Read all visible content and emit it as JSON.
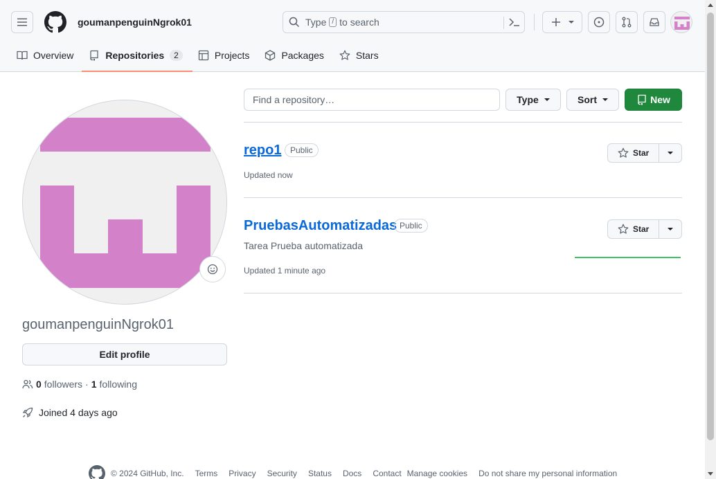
{
  "header": {
    "username": "goumanpenguinNgrok01",
    "search_text_before": "Type",
    "search_key": "/",
    "search_text_after": "to search"
  },
  "nav": {
    "overview": "Overview",
    "repositories": "Repositories",
    "repositories_count": "2",
    "projects": "Projects",
    "packages": "Packages",
    "stars": "Stars"
  },
  "profile": {
    "name": "goumanpenguinNgrok01",
    "edit_label": "Edit profile",
    "followers_count": "0",
    "followers_label": "followers",
    "separator": "·",
    "following_count": "1",
    "following_label": "following",
    "joined": "Joined 4 days ago"
  },
  "repo_toolbar": {
    "find_placeholder": "Find a repository…",
    "type_label": "Type",
    "sort_label": "Sort",
    "new_label": "New"
  },
  "repos": [
    {
      "name": "repo1",
      "visibility": "Public",
      "description": "",
      "updated": "Updated now",
      "star_label": "Star"
    },
    {
      "name": "PruebasAutomatizadas",
      "visibility": "Public",
      "description": "Tarea Prueba automatizada",
      "updated": "Updated 1 minute ago",
      "star_label": "Star"
    }
  ],
  "footer": {
    "copyright": "© 2024 GitHub, Inc.",
    "links": [
      "Terms",
      "Privacy",
      "Security",
      "Status",
      "Docs",
      "Contact",
      "Manage cookies",
      "Do not share my personal information"
    ]
  },
  "colors": {
    "accent_new": "#1f883d",
    "link": "#0969da",
    "tab_underline": "#fd8c73",
    "avatar_pink": "#d382c9"
  }
}
